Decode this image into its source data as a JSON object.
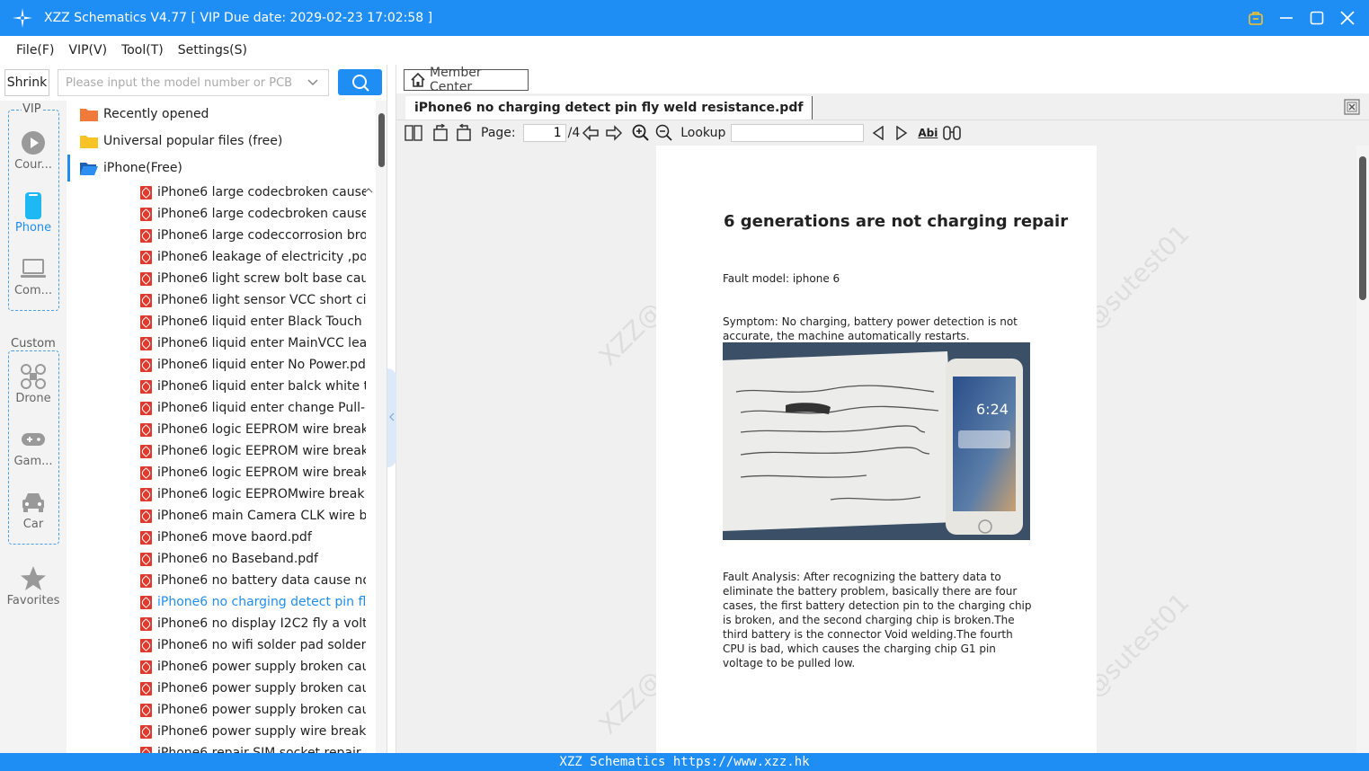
{
  "window": {
    "title": "XZZ Schematics V4.77 [ VIP Due date: 2029-02-23 17:02:58 ]"
  },
  "menu": [
    "File(F)",
    "VIP(V)",
    "Tool(T)",
    "Settings(S)"
  ],
  "search": {
    "shrink_label": "Shrink",
    "placeholder": "Please input the model number or PCB"
  },
  "categories": {
    "vip_label": "VIP",
    "custom_label": "Custom",
    "items": [
      {
        "label": "Cour...",
        "icon": "play-circle-icon"
      },
      {
        "label": "Phone",
        "icon": "phone-icon"
      },
      {
        "label": "Com...",
        "icon": "laptop-icon"
      },
      {
        "label": "Drone",
        "icon": "drone-icon"
      },
      {
        "label": "Gam...",
        "icon": "gamepad-icon"
      },
      {
        "label": "Car",
        "icon": "car-icon"
      },
      {
        "label": "Favorites",
        "icon": "star-icon"
      }
    ]
  },
  "tree": {
    "folders": [
      {
        "label": "Recently opened",
        "color": "#f07a3a"
      },
      {
        "label": "Universal popular files (free)",
        "color": "#f7c325"
      },
      {
        "label": "iPhone(Free)",
        "color": "#2b7be4"
      }
    ],
    "files": [
      "iPhone6 large codecbroken cause",
      "iPhone6 large codecbroken cause",
      "iPhone6 large codeccorrosion brol",
      "iPhone6 leakage of electricity ,pow",
      "iPhone6 light screw bolt base caus",
      "iPhone6 light sensor VCC short circ",
      "iPhone6 liquid enter Black Touch (",
      "iPhone6 liquid enter MainVCC leal",
      "iPhone6 liquid enter No Power.pdf",
      "iPhone6 liquid enter balck white to",
      "iPhone6 liquid enter change Pull-u",
      "iPhone6 logic EEPROM wire break",
      "iPhone6 logic EEPROM wire break",
      "iPhone6 logic EEPROM wire break",
      "iPhone6 logic EEPROMwire break",
      "iPhone6 main Camera CLK wire bre",
      "iPhone6 move baord.pdf",
      "iPhone6 no Baseband.pdf",
      "iPhone6 no battery data cause no",
      "iPhone6 no charging detect pin fly",
      "iPhone6 no display I2C2 fly a volta",
      "iPhone6 no wifi solder pad solder",
      "iPhone6 power supply broken cau",
      "iPhone6 power supply broken cau",
      "iPhone6 power supply broken cau",
      "iPhone6 power supply wire break",
      "iPhone6 repair SIM socket repair s"
    ],
    "active_index": 19
  },
  "viewer": {
    "member_center": "Member Center",
    "tab_title": "iPhone6 no charging detect pin fly weld resistance.pdf",
    "page_label": "Page:",
    "page_current": "1",
    "page_total": "/4",
    "lookup_label": "Lookup",
    "abi_label": "Abi"
  },
  "pdf": {
    "heading": "6 generations are not charging repair",
    "fault_model": "Fault model: iphone 6",
    "symptom": "Symptom: No charging, battery power detection is not accurate, the machine automatically restarts.",
    "analysis": "Fault Analysis: After recognizing the battery data to eliminate the battery problem, basically there are four cases, the first battery detection pin to the charging chip is broken, and the second charging chip is broken.The third battery is the connector Void welding.The fourth CPU is bad, which causes the charging chip G1 pin voltage to be pulled low.",
    "watermark": "XZZ@sutest01",
    "photo_time": "6:24"
  },
  "status": {
    "text": "XZZ Schematics https://www.xzz.hk"
  },
  "colors": {
    "accent": "#1e8ef5",
    "pdf_icon": "#e03a2f"
  }
}
